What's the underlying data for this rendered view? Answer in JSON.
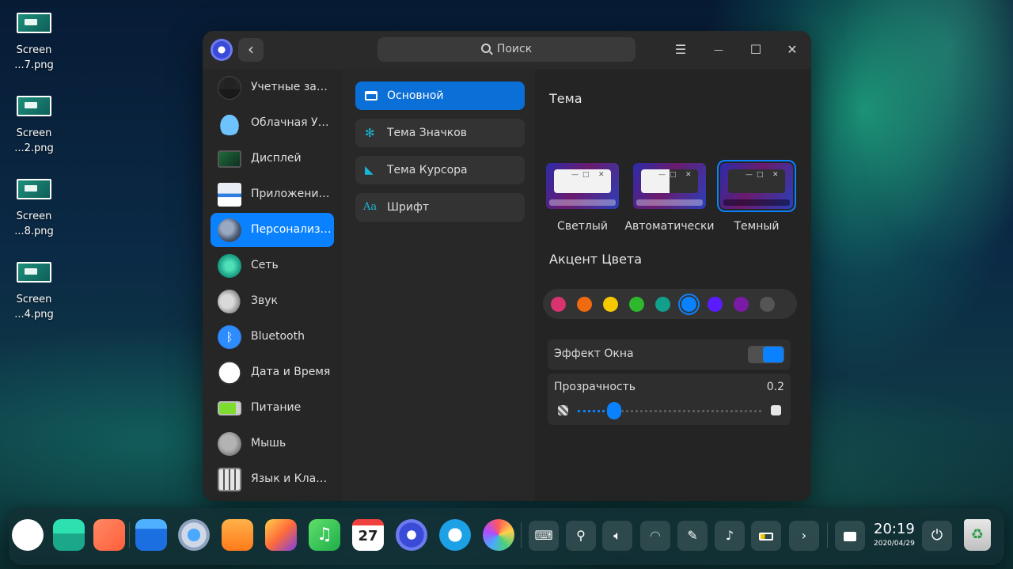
{
  "desktop": {
    "icons": [
      {
        "line1": "Screen",
        "line2": "...7.png"
      },
      {
        "line1": "Screen",
        "line2": "...2.png"
      },
      {
        "line1": "Screen",
        "line2": "...8.png"
      },
      {
        "line1": "Screen",
        "line2": "...4.png"
      }
    ]
  },
  "window": {
    "back_glyph": "‹",
    "search_placeholder": "Поиск",
    "menu_glyph": "☰",
    "minimize_glyph": "—",
    "maximize_glyph": "☐",
    "close_glyph": "✕"
  },
  "sidebar": {
    "items": [
      {
        "label": "Учетные записи",
        "icon": "user-accounts-icon"
      },
      {
        "label": "Облачная Учетная запись",
        "icon": "cloud-icon"
      },
      {
        "label": "Дисплей",
        "icon": "display-icon"
      },
      {
        "label": "Приложения по умолчанию",
        "icon": "default-apps-icon"
      },
      {
        "label": "Персонализация",
        "icon": "personalization-icon"
      },
      {
        "label": "Сеть",
        "icon": "network-icon"
      },
      {
        "label": "Звук",
        "icon": "sound-icon"
      },
      {
        "label": "Bluetooth",
        "icon": "bluetooth-icon"
      },
      {
        "label": "Дата и Время",
        "icon": "clock-icon"
      },
      {
        "label": "Питание",
        "icon": "battery-icon"
      },
      {
        "label": "Мышь",
        "icon": "mouse-icon"
      },
      {
        "label": "Язык и  Клавиатура",
        "icon": "keyboard-icon"
      }
    ],
    "active": "Персонализация"
  },
  "subnav": {
    "items": [
      {
        "label": "Основной",
        "icon": "window-icon"
      },
      {
        "label": "Тема Значков",
        "icon": "icon-theme-icon"
      },
      {
        "label": "Тема Курсора",
        "icon": "cursor-icon"
      },
      {
        "label": "Шрифт",
        "icon": "font-icon"
      }
    ],
    "active": "Основной"
  },
  "content": {
    "theme_title": "Тема",
    "themes": [
      {
        "label": "Светлый",
        "selected": false
      },
      {
        "label": "Автоматически",
        "selected": false
      },
      {
        "label": "Темный",
        "selected": true
      }
    ],
    "accent_title": "Акцент Цвета",
    "accent_colors": [
      "#d8336e",
      "#f06a0f",
      "#f5c800",
      "#2eb82e",
      "#12a08c",
      "#0a82ff",
      "#5a1cff",
      "#7a1aa6",
      "#555555"
    ],
    "accent_selected": "#0a82ff",
    "window_effect_label": "Эффект Окна",
    "window_effect_on": true,
    "transparency_label": "Прозрачность",
    "transparency_value": "0.2",
    "transparency_fraction": 0.2
  },
  "dock": {
    "apps": [
      "launcher-icon",
      "multitask-view-icon",
      "app-store-icon",
      "file-manager-icon",
      "browser-icon",
      "app-store-bag-icon",
      "image-viewer-icon",
      "music-icon",
      "calendar-icon",
      "settings-icon",
      "deepin-assistant-icon",
      "draw-icon"
    ],
    "calendar_day": "27",
    "tray": [
      "keyboard-icon",
      "usb-icon",
      "volume-icon",
      "wifi-icon",
      "pen-icon",
      "bell-icon",
      "battery-icon",
      "chevron-right-icon",
      "input-method-icon"
    ],
    "time": "20:19",
    "date": "2020/04/29"
  }
}
